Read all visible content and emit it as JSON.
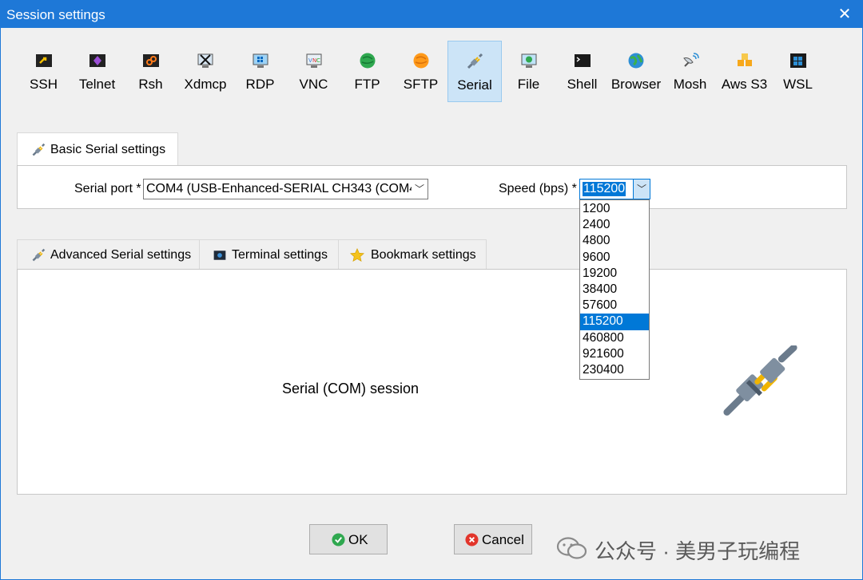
{
  "window": {
    "title": "Session settings",
    "close_glyph": "✕"
  },
  "toolbar": {
    "items": [
      {
        "label": "SSH",
        "icon": "ssh-icon"
      },
      {
        "label": "Telnet",
        "icon": "telnet-icon"
      },
      {
        "label": "Rsh",
        "icon": "rsh-icon"
      },
      {
        "label": "Xdmcp",
        "icon": "xdmcp-icon"
      },
      {
        "label": "RDP",
        "icon": "rdp-icon"
      },
      {
        "label": "VNC",
        "icon": "vnc-icon"
      },
      {
        "label": "FTP",
        "icon": "ftp-icon"
      },
      {
        "label": "SFTP",
        "icon": "sftp-icon"
      },
      {
        "label": "Serial",
        "icon": "serial-plug-icon",
        "active": true
      },
      {
        "label": "File",
        "icon": "file-icon"
      },
      {
        "label": "Shell",
        "icon": "shell-icon"
      },
      {
        "label": "Browser",
        "icon": "browser-globe-icon"
      },
      {
        "label": "Mosh",
        "icon": "mosh-satellite-icon"
      },
      {
        "label": "Aws S3",
        "icon": "aws-s3-icon"
      },
      {
        "label": "WSL",
        "icon": "wsl-windows-icon"
      }
    ]
  },
  "basic": {
    "tab_label": "Basic Serial settings",
    "serial_port_label": "Serial port *",
    "serial_port_value": "COM4  (USB-Enhanced-SERIAL CH343 (COM4",
    "speed_label": "Speed (bps) *",
    "speed_value": "115200",
    "speed_options": [
      "1200",
      "2400",
      "4800",
      "9600",
      "19200",
      "38400",
      "57600",
      "115200",
      "460800",
      "921600",
      "230400"
    ],
    "speed_selected": "115200"
  },
  "tabs": {
    "advanced": "Advanced Serial settings",
    "terminal": "Terminal settings",
    "bookmark": "Bookmark settings"
  },
  "main": {
    "session_text": "Serial (COM) session"
  },
  "buttons": {
    "ok": "OK",
    "cancel": "Cancel"
  },
  "watermark": {
    "text": "公众号 · 美男子玩编程"
  },
  "colors": {
    "accent": "#1e78d7",
    "selection": "#0078d7",
    "active_tool_bg": "#cce4f7"
  }
}
